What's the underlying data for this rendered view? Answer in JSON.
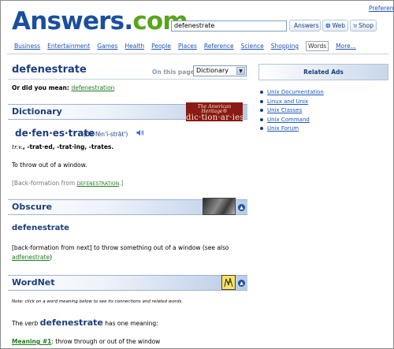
{
  "header": {
    "logo": {
      "answers": "Answers",
      "dot": ".",
      "com": "com",
      "tm": "TM"
    },
    "preferences_link": "Preferences",
    "search": {
      "value": "defenestrate"
    },
    "buttons": {
      "answers": "Answers",
      "web": "Web",
      "shop": "Shop"
    }
  },
  "nav": {
    "items": [
      "Business",
      "Entertainment",
      "Games",
      "Health",
      "People",
      "Places",
      "Reference",
      "Science",
      "Shopping",
      "Words",
      "More..."
    ],
    "active": "Words"
  },
  "word": {
    "title": "defenestrate",
    "on_this_page_label": "On this page:",
    "on_this_page_value": "Dictionary"
  },
  "did_you_mean": {
    "label": "Or did you mean:",
    "suggestion": "defenestration"
  },
  "dictionary": {
    "title": "Dictionary",
    "logo_line1": "The American Heritage®",
    "logo_line2": "dic·tion·ar·ies",
    "headword": "de·fen·es·trate",
    "pronunciation": "(dē-fĕn'ĭ-strāt')",
    "pos": "tr.v.",
    "inflections": ", -trat·ed, -trat·ing, -trates.",
    "definition": "To throw out of a window.",
    "etymology_prefix": "[Back-formation from ",
    "etymology_link": "DEFENESTRATION",
    "etymology_suffix": ".]"
  },
  "obscure": {
    "title": "Obscure",
    "word": "defenestrate",
    "definition": "[back-formation from next] to throw something out of a window (see also",
    "see_also_link": "adfenestrate",
    "see_also_suffix": ")"
  },
  "wordnet": {
    "title": "WordNet",
    "note": "Note: click on a word meaning below to see its connections and related words.",
    "verb_prefix": "The ",
    "verb_pos": "verb",
    "verb_word": "defenestrate",
    "verb_suffix": " has one meaning:",
    "meaning_link": "Meaning #1",
    "meaning_text": ": throw through or out of the window"
  },
  "ads": {
    "title": "Related Ads",
    "items": [
      "Unix Documentation",
      "Linux and Unix",
      "Unix Classes",
      "Unix Command",
      "Unix Forum"
    ]
  }
}
